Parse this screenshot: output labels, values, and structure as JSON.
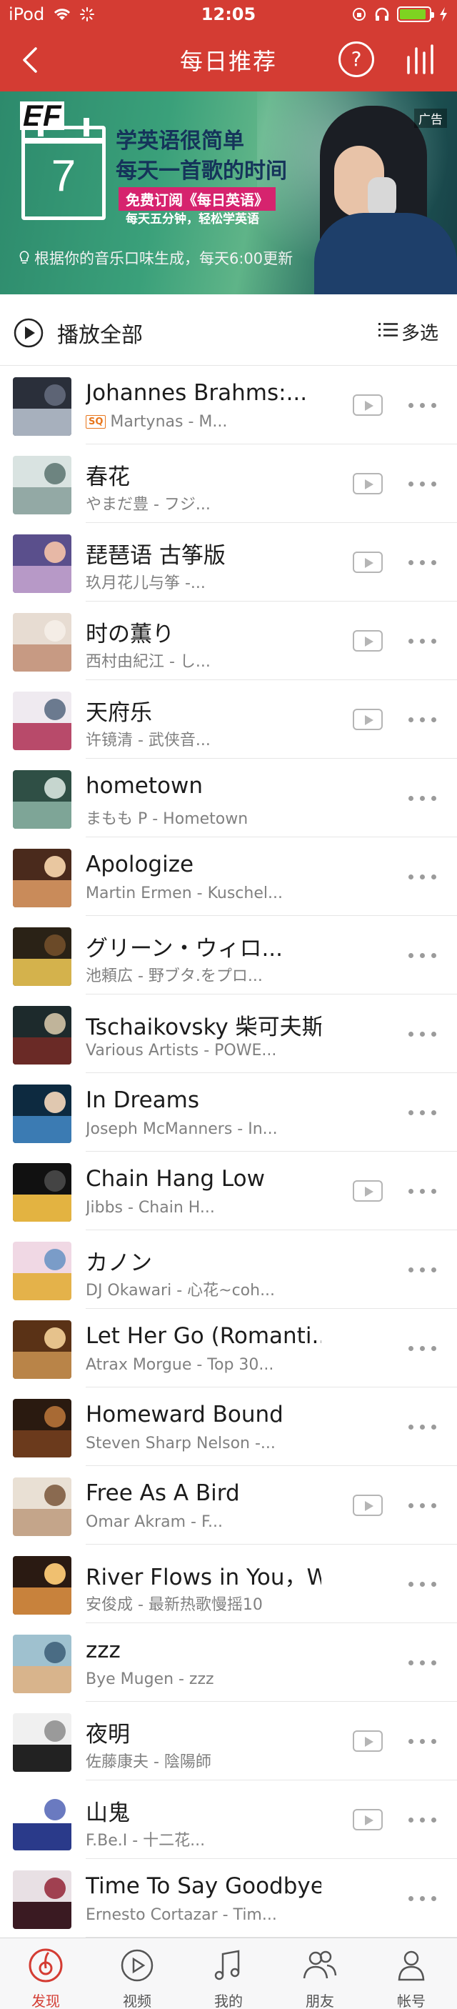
{
  "status_bar": {
    "carrier": "iPod",
    "time": "12:05"
  },
  "nav": {
    "title": "每日推荐",
    "help_symbol": "?"
  },
  "banner": {
    "logo": "EF",
    "calendar_day": "7",
    "headline_1": "学英语很简单",
    "headline_2": "每天一首歌的时间",
    "subscribe": "免费订阅《每日英语》",
    "tagline": "每天五分钟，轻松学英语",
    "ad_tag": "广告",
    "note": "根据你的音乐口味生成，每天6:00更新"
  },
  "toolbar": {
    "play_all": "播放全部",
    "multi_select": "多选"
  },
  "songs": [
    {
      "title": "Johannes Brahms:...",
      "subtitle": "Martynas - M...",
      "sq": "SQ",
      "mv": true
    },
    {
      "title": "春花",
      "subtitle": "やまだ豊 - フジ...",
      "mv": true
    },
    {
      "title": "琵琶语 古筝版",
      "subtitle": "玖月花儿与筝 -...",
      "mv": true
    },
    {
      "title": "时の薫り",
      "subtitle": "西村由紀江 - し...",
      "mv": true
    },
    {
      "title": "天府乐",
      "subtitle": "许镜清 - 武侠音...",
      "mv": true
    },
    {
      "title": "hometown",
      "subtitle": "まもも P - Hometown",
      "mv": false
    },
    {
      "title": "Apologize",
      "subtitle": "Martin Ermen - Kuschel...",
      "mv": false
    },
    {
      "title": "グリーン・ウィロ...",
      "subtitle": "池頼広 - 野ブタ.をプロ...",
      "mv": false
    },
    {
      "title": "Tschaikovsky 柴可夫斯...",
      "subtitle": "Various Artists - POWE...",
      "mv": false
    },
    {
      "title": "In Dreams",
      "subtitle": "Joseph McManners - In...",
      "mv": false
    },
    {
      "title": "Chain Hang Low",
      "subtitle": "Jibbs - Chain H...",
      "mv": true
    },
    {
      "title": "カノン",
      "subtitle": "DJ Okawari - 心花~coh...",
      "mv": false
    },
    {
      "title": "Let Her Go (Romanti...",
      "subtitle": "Atrax Morgue - Top 30...",
      "mv": false
    },
    {
      "title": "Homeward Bound",
      "subtitle": "Steven Sharp Nelson -...",
      "mv": false
    },
    {
      "title": "Free As A Bird",
      "subtitle": "Omar Akram - F...",
      "mv": true
    },
    {
      "title": "River Flows in You，We...",
      "subtitle": "安俊成 - 最新热歌慢摇10",
      "mv": false
    },
    {
      "title": "zzz",
      "subtitle": "Bye Mugen - zzz",
      "mv": false
    },
    {
      "title": "夜明",
      "subtitle": "佐藤康夫 - 陰陽師",
      "mv": true
    },
    {
      "title": "山鬼",
      "subtitle": "F.Be.I - 十二花...",
      "mv": true
    },
    {
      "title": "Time To Say Goodbye",
      "subtitle": "Ernesto Cortazar - Tim...",
      "mv": false
    }
  ],
  "tabs": [
    {
      "label": "发现",
      "icon": "discover-icon",
      "active": true
    },
    {
      "label": "视频",
      "icon": "video-icon",
      "active": false
    },
    {
      "label": "我的",
      "icon": "music-note-icon",
      "active": false
    },
    {
      "label": "朋友",
      "icon": "friends-icon",
      "active": false
    },
    {
      "label": "帐号",
      "icon": "account-icon",
      "active": false
    }
  ],
  "colors": {
    "brand_red": "#d43c33",
    "sq_orange": "#e8761c",
    "battery_green": "#7ed321"
  }
}
